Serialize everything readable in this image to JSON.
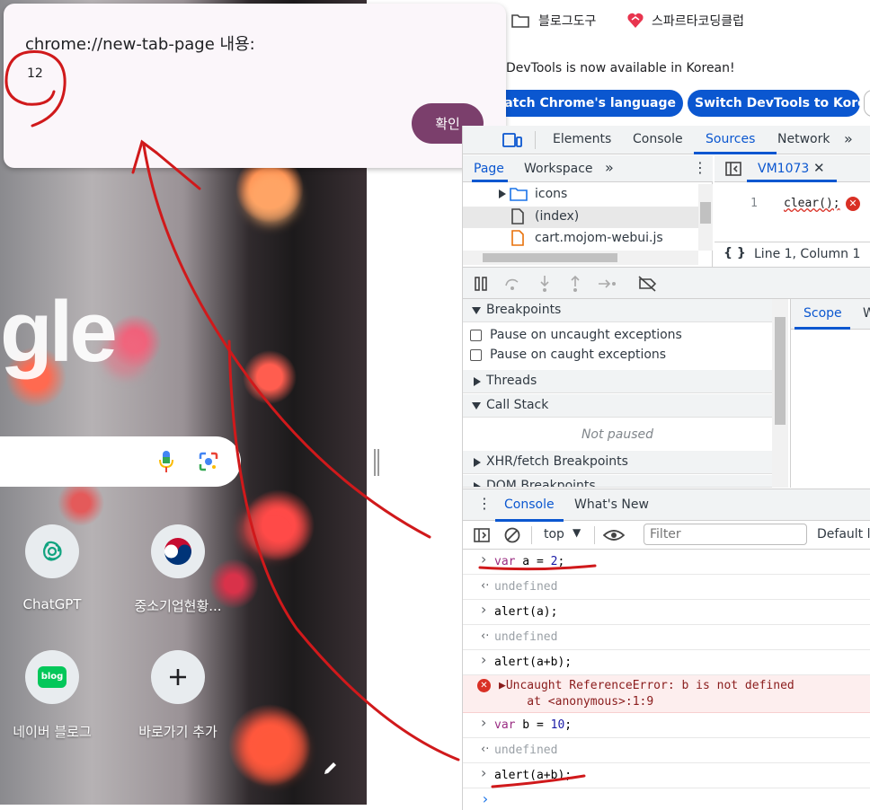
{
  "alert": {
    "title": "chrome://new-tab-page 내용:",
    "message": "12",
    "ok_label": "확인"
  },
  "bookmarks": [
    {
      "label": "블로그도구",
      "icon": "folder-icon"
    },
    {
      "label": "스파르타코딩클럽",
      "icon": "sparta-logo-icon"
    }
  ],
  "devtools_banner": {
    "text": "DevTools is now available in Korean!",
    "match_button": "Always match Chrome's language",
    "switch_button": "Switch DevTools to Korean"
  },
  "ntp": {
    "logo_fragment": "gle",
    "shortcuts": [
      {
        "label": "ChatGPT",
        "icon": "chatgpt-icon"
      },
      {
        "label": "중소기업현황...",
        "icon": "korea-flag-icon"
      },
      {
        "label": "네이버 블로그",
        "icon": "naver-blog-icon"
      },
      {
        "label": "바로가기 추가",
        "icon": "plus-icon"
      }
    ],
    "blog_badge": "blog"
  },
  "devtools": {
    "tabs": [
      "Elements",
      "Console",
      "Sources",
      "Network"
    ],
    "active_tab": "Sources",
    "nav_subtabs": [
      "Page",
      "Workspace"
    ],
    "files": [
      {
        "label": "icons",
        "icon": "folder-icon"
      },
      {
        "label": "(index)",
        "icon": "document-icon"
      },
      {
        "label": "cart.mojom-webui.js",
        "icon": "js-file-icon"
      }
    ],
    "editor": {
      "file_tab": "VM1073",
      "line_number": "1",
      "code": "clear();",
      "status": "Line 1, Column 1"
    },
    "scope_tabs": [
      "Scope",
      "W"
    ],
    "sections": {
      "breakpoints": "Breakpoints",
      "pause_uncaught": "Pause on uncaught exceptions",
      "pause_caught": "Pause on caught exceptions",
      "threads": "Threads",
      "call_stack": "Call Stack",
      "not_paused": "Not paused",
      "xhr": "XHR/fetch Breakpoints",
      "dom": "DOM Breakpoints"
    },
    "drawer_tabs": [
      "Console",
      "What's New"
    ],
    "console_toolbar": {
      "context": "top",
      "filter_placeholder": "Filter",
      "levels": "Default le"
    },
    "console": [
      {
        "kind": "input",
        "parts": [
          [
            "kw",
            "var"
          ],
          [
            "",
            " a = "
          ],
          [
            "num",
            "2"
          ],
          [
            "",
            ";"
          ]
        ]
      },
      {
        "kind": "output",
        "text": "undefined"
      },
      {
        "kind": "input",
        "parts": [
          [
            "",
            "alert(a);"
          ]
        ]
      },
      {
        "kind": "output",
        "text": "undefined"
      },
      {
        "kind": "input",
        "parts": [
          [
            "",
            "alert(a+b);"
          ]
        ]
      },
      {
        "kind": "error",
        "line1": "▶Uncaught ReferenceError: b is not defined",
        "line2": "    at <anonymous>:1:9"
      },
      {
        "kind": "input",
        "parts": [
          [
            "kw",
            "var"
          ],
          [
            "",
            " b = "
          ],
          [
            "num",
            "10"
          ],
          [
            "",
            ";"
          ]
        ]
      },
      {
        "kind": "output",
        "text": "undefined"
      },
      {
        "kind": "input",
        "parts": [
          [
            "",
            "alert(a+b);"
          ]
        ]
      }
    ]
  },
  "colors": {
    "accent": "#0b57d0",
    "ok_button": "#7b3f6c",
    "annotation": "#d0191b",
    "error_bg": "#fdeeee"
  }
}
